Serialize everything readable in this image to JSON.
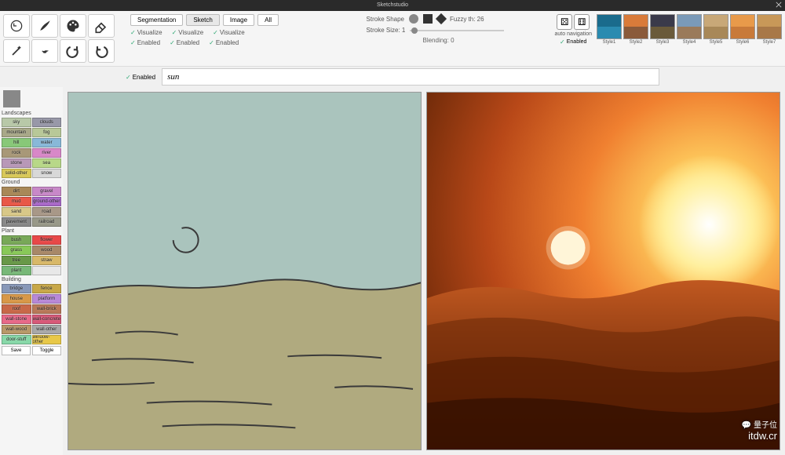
{
  "window": {
    "title": "Sketchstudio"
  },
  "toolbar": {
    "seg_label": "Segmentation",
    "seg_options": [
      "Sketch",
      "Image",
      "All"
    ],
    "checks": {
      "row1": [
        "Visualize",
        "Visualize",
        "Visualize"
      ],
      "row2": [
        "Enabled",
        "Enabled",
        "Enabled"
      ]
    },
    "stroke_shape_label": "Stroke Shape",
    "fuzzy_label": "Fuzzy th: 26",
    "stroke_size_label": "Stroke Size: 1",
    "blending_label": "Blending: 0",
    "enabled_label": "Enabled",
    "auto_nav": "auto navigation"
  },
  "styles": [
    {
      "label": "Style1",
      "colors": [
        "#1a6b8c",
        "#2a8bb0"
      ]
    },
    {
      "label": "Style2",
      "colors": [
        "#d97b3a",
        "#8a5a3a"
      ]
    },
    {
      "label": "Style3",
      "colors": [
        "#3a3a4a",
        "#6a5a3a"
      ]
    },
    {
      "label": "Style4",
      "colors": [
        "#7a9ab8",
        "#9a7a5a"
      ]
    },
    {
      "label": "Style5",
      "colors": [
        "#c8a878",
        "#a88858"
      ]
    },
    {
      "label": "Style6",
      "colors": [
        "#e89a4a",
        "#c87a3a"
      ]
    },
    {
      "label": "Style7",
      "colors": [
        "#c89858",
        "#a87848"
      ]
    }
  ],
  "input": {
    "value": "sun"
  },
  "palette": {
    "sections": [
      {
        "title": "Landscapes",
        "items": [
          {
            "name": "sky",
            "c": "#b8c8a8"
          },
          {
            "name": "clouds",
            "c": "#9898a8"
          },
          {
            "name": "mountain",
            "c": "#a8a888"
          },
          {
            "name": "fog",
            "c": "#b8c898"
          },
          {
            "name": "hill",
            "c": "#88c878"
          },
          {
            "name": "water",
            "c": "#88b8d8"
          },
          {
            "name": "rock",
            "c": "#a89878"
          },
          {
            "name": "river",
            "c": "#d888c8"
          },
          {
            "name": "stone",
            "c": "#b898b8"
          },
          {
            "name": "sea",
            "c": "#b8d888"
          },
          {
            "name": "solid-other",
            "c": "#d8c858"
          },
          {
            "name": "snow",
            "c": "#d8d8d8"
          }
        ]
      },
      {
        "title": "Ground",
        "items": [
          {
            "name": "dirt",
            "c": "#a88858"
          },
          {
            "name": "gravel",
            "c": "#c888c8"
          },
          {
            "name": "mud",
            "c": "#e85848"
          },
          {
            "name": "ground-other",
            "c": "#a868c8"
          },
          {
            "name": "sand",
            "c": "#d8c888"
          },
          {
            "name": "road",
            "c": "#a89888"
          },
          {
            "name": "pavement",
            "c": "#888888"
          },
          {
            "name": "railroad",
            "c": "#989888"
          }
        ]
      },
      {
        "title": "Plant",
        "items": [
          {
            "name": "bush",
            "c": "#78a858"
          },
          {
            "name": "flower",
            "c": "#e84848"
          },
          {
            "name": "grass",
            "c": "#88c858"
          },
          {
            "name": "wood",
            "c": "#a88868"
          },
          {
            "name": "tree",
            "c": "#689848"
          },
          {
            "name": "straw",
            "c": "#d8b868"
          },
          {
            "name": "plant",
            "c": "#78b878"
          },
          {
            "name": "",
            "c": "#e8e8e8"
          }
        ]
      },
      {
        "title": "Building",
        "items": [
          {
            "name": "bridge",
            "c": "#8898b8"
          },
          {
            "name": "fence",
            "c": "#c8a848"
          },
          {
            "name": "house",
            "c": "#d89848"
          },
          {
            "name": "platform",
            "c": "#b888d8"
          },
          {
            "name": "roof",
            "c": "#c86848"
          },
          {
            "name": "wall-brick",
            "c": "#b87858"
          },
          {
            "name": "wall-stone",
            "c": "#e86888"
          },
          {
            "name": "wall-concrete",
            "c": "#d85878"
          },
          {
            "name": "wall-wood",
            "c": "#b89868"
          },
          {
            "name": "wall-other",
            "c": "#a8a8a8"
          },
          {
            "name": "door-stuff",
            "c": "#88d8a8"
          },
          {
            "name": "window-other",
            "c": "#e8c848"
          }
        ]
      }
    ],
    "save_btn": "Save",
    "toggle_btn": "Toggle"
  },
  "watermark": {
    "chat": "量子位",
    "site": "itdw.cr"
  }
}
